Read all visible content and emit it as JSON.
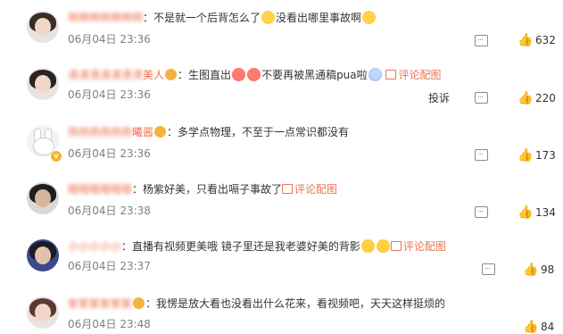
{
  "comments": [
    {
      "username": "啊啊啊啊啊啊啊",
      "text": "不是就一个后背怎么了",
      "text2": "没看出哪里事故啊",
      "time": "06月04日 23:36",
      "likes": "632"
    },
    {
      "username": "清清清清清清清",
      "username_suffix": "美人",
      "text": "生图直出",
      "text2": "不要再被黑通稿pua啦",
      "link": "评论配图",
      "time": "06月04日 23:36",
      "report": "投诉",
      "likes": "220"
    },
    {
      "username": "扬扬扬扬扬扬",
      "username_suffix": "曦酱",
      "text": "多学点物理，不至于一点常识都没有",
      "time": "06月04日 23:36",
      "likes": "173"
    },
    {
      "username": "瞎瞎瞎瞎瞎瞎",
      "text": "杨紫好美，只看出嗝子事故了",
      "link": "评论配图",
      "time": "06月04日 23:38",
      "likes": "134"
    },
    {
      "username": "小小小小小",
      "text": "直播有视频更美哦 镜子里还是我老婆好美的背影",
      "link": "评论配图",
      "time": "06月04日 23:37",
      "likes": "98"
    },
    {
      "username": "紫紫紫紫紫紫",
      "text": "我愣是放大看也没看出什么花来，看视频吧，天天这样挺烦的",
      "time": "06月04日 23:48",
      "likes": "84"
    }
  ],
  "icons": {
    "reply": "comment-icon",
    "like": "thumb-up-icon",
    "image": "image-icon",
    "level": "level-badge-icon",
    "verified": "verified-badge-icon"
  },
  "colors": {
    "username": "#eb7350",
    "link": "#eb7350",
    "time": "#808080",
    "badge": "#f5b42a"
  }
}
